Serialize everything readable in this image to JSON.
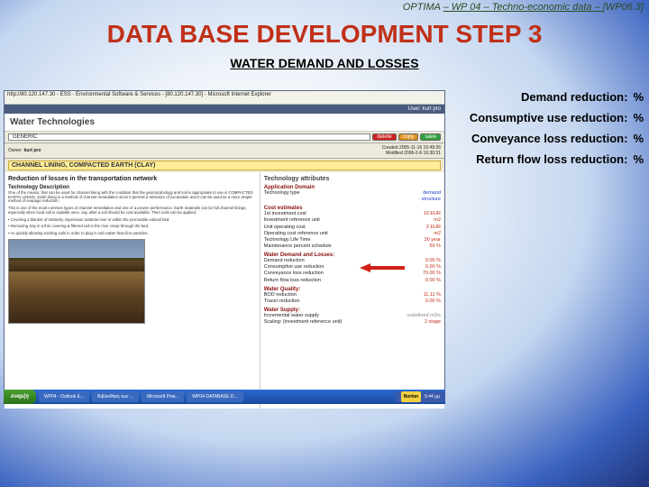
{
  "header_note_pre": "OPTIMA ",
  "header_note_mid": "– WP 04 – Techno-economic data – ",
  "header_note_post": "[WP06.3]",
  "title": "DATA BASE DEVELOPMENT STEP 3",
  "subtitle": "WATER DEMAND AND LOSSES",
  "side": {
    "rows": [
      {
        "label": "Demand reduction:",
        "pct": "%"
      },
      {
        "label": "Consumptive use reduction:",
        "pct": "%"
      },
      {
        "label": "Conveyance loss reduction:",
        "pct": "%"
      },
      {
        "label": "Return flow loss reduction:",
        "pct": "%"
      }
    ]
  },
  "shot": {
    "addr": "http://80.120.147.30 - ESS - Environmental Software & Services - [80.120.147.30] - Microsoft Internet Explorer",
    "user": "User: kurt pro",
    "panel_title": "Water Technologies",
    "class_label": "GENERIC",
    "btn_delete": "delete",
    "btn_copy": "copy",
    "btn_save": "save",
    "owner_label": "Owner",
    "owner_value": "kurt pro",
    "created": "Created 2005-11-16 15:49:26",
    "modified": "Modified 2006-2-6 16:30:31",
    "selected_tech": "CHANNEL LINING, COMPACTED EARTH (CLAY)",
    "left_title": "Reduction of losses in the transportation network",
    "desc_heading": "Technology Description",
    "desc1": "One of the means, that can be used for channel lining with the condition that the geomorphology and soil is appropriate to use is COMPACTED EARTH LINING. Earth lining is a method of channel remediation since it permits a minimum of excavation and it can be used as a more simple method of seepage reduction.",
    "desc2": "This is one of the most common types of channel remediation and one of a proven performance. Earth materials can be full channel linings, especially when local soil is suitable once, say, after a soil should be cost available. Then soils can be applied.",
    "desc3": "• Covering a blanket of relatively impervious material over or within the permeable subsoil bed.",
    "desc4": "• Removing clay in a thin covering & filtered soil in the river creep through the bed.",
    "desc5": "• As quickly allowing existing soils in order to plug in soil matter than fine particles.",
    "right_title": "Technology attributes",
    "sections": {
      "app": {
        "title": "Application Domain",
        "rows": [
          {
            "k": "Technology type",
            "v": "demand",
            "cls": "blue"
          },
          {
            "k": " ",
            "v": "· structure",
            "cls": "blue"
          }
        ]
      },
      "cost": {
        "title": "Cost estimates",
        "rows": [
          {
            "k": "1st investment cost",
            "v": "10 EUR"
          },
          {
            "k": "Investment reference unit",
            "v": "m2"
          },
          {
            "k": "Unit operating cost",
            "v": "3 EUR"
          },
          {
            "k": "Operating cost reference unit",
            "v": "m2"
          },
          {
            "k": "Technology Life Time",
            "v": "30 year"
          },
          {
            "k": "Maintenance percent schedule",
            "v": "50 %"
          }
        ]
      },
      "demand": {
        "title": "Water Demand and Losses:",
        "rows": [
          {
            "k": "Demand reduction",
            "v": "0.00 %"
          },
          {
            "k": "Consumptive use reduction",
            "v": "0.00 %",
            "arrow": true
          },
          {
            "k": "Conveyance loss reduction",
            "v": "70.00 %"
          },
          {
            "k": "Return flow loss reduction",
            "v": "0.00 %"
          }
        ]
      },
      "quality": {
        "title": "Water Quality:",
        "rows": [
          {
            "k": "BOD reduction",
            "v": "11.11 %"
          },
          {
            "k": "Tracer reduction",
            "v": "0.00 %"
          }
        ]
      },
      "supply": {
        "title": "Water Supply:",
        "rows": [
          {
            "k": "Incremental water supply",
            "v": "undefined m3/s",
            "cls": "gray"
          },
          {
            "k": "Scaling: (investment reference unit)",
            "v": "2 stage"
          }
        ]
      }
    }
  },
  "taskbar": {
    "start": "έναρξη",
    "tasks": [
      "WP04 - Outlook E...",
      "Βιβλιοθήκη των ...",
      "Microsoft Pow...",
      "WP04-DATABASE D..."
    ],
    "noti_label": "Norton",
    "time": "5:44 μμ"
  }
}
